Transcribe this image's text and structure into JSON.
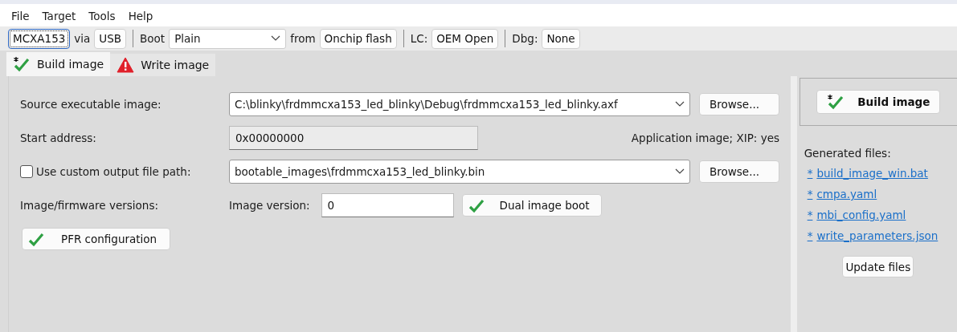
{
  "menu": [
    "File",
    "Target",
    "Tools",
    "Help"
  ],
  "toolbar": {
    "device": "MCXA153",
    "via_label": "via",
    "interface": "USB",
    "boot_label": "Boot",
    "boot_value": "Plain",
    "from_label": "from",
    "memory": "Onchip flash",
    "lc_label": "LC:",
    "lifecycle": "OEM Open",
    "dbg_label": "Dbg:",
    "debug": "None"
  },
  "tabs": [
    {
      "label": "Build image",
      "selected": true,
      "kind": "ok",
      "modified": true
    },
    {
      "label": "Write image",
      "selected": false,
      "kind": "warning",
      "modified": false
    }
  ],
  "form": {
    "source_label": "Source executable image:",
    "source_value": "C:\\blinky\\frdmmcxa153_led_blinky\\Debug\\frdmmcxa153_led_blinky.axf",
    "browse_1": "Browse...",
    "start_label": "Start address:",
    "start_value": "0x00000000",
    "app_info": "Application image; XIP: yes",
    "custom_output": {
      "label": "Use custom output file path:",
      "checked": false
    },
    "output_value": "bootable_images\\frdmmcxa153_led_blinky.bin",
    "browse_2": "Browse...",
    "versions_label": "Image/firmware versions:",
    "image_version_label": "Image version:",
    "image_version_value": "0",
    "dual_boot": {
      "label": "Dual image boot",
      "kind": "ok"
    },
    "pfr": {
      "label": "PFR configuration",
      "kind": "ok"
    }
  },
  "side": {
    "build_button": {
      "label": "Build image",
      "kind": "ok",
      "modified": true
    },
    "generated_label": "Generated files:",
    "files": [
      {
        "mark": "*",
        "name": "build_image_win.bat"
      },
      {
        "mark": "*",
        "name": "cmpa.yaml"
      },
      {
        "mark": "*",
        "name": "mbi_config.yaml"
      },
      {
        "mark": "*",
        "name": "write_parameters.json"
      }
    ],
    "update_button": "Update files"
  }
}
